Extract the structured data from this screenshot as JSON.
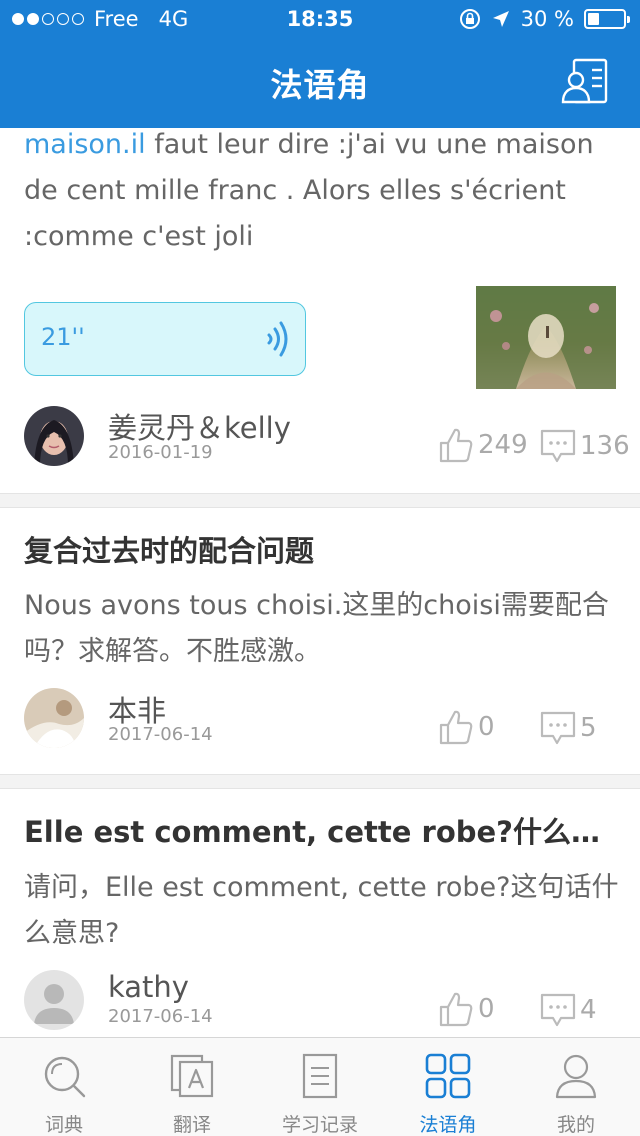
{
  "status_bar": {
    "carrier": "Free",
    "network": "4G",
    "time": "18:35",
    "battery_text": "30 %",
    "battery_level": 0.3,
    "signal_bars_filled": 2,
    "signal_bars_total": 5
  },
  "header": {
    "title": "法语角"
  },
  "colors": {
    "primary": "#1a7fd4",
    "link": "#3a9be0",
    "voice_bg": "#d8f7fb"
  },
  "posts": [
    {
      "body_link": "maison.il",
      "body_rest": " faut leur dire :j'ai vu une maison de cent mille franc . Alors elles s'écrient :comme c'est joli",
      "voice_duration": "21''",
      "author": "姜灵丹＆kelly",
      "date": "2016-01-19",
      "likes": "249",
      "comments": "136"
    },
    {
      "title": "复合过去时的配合问题",
      "body": "Nous avons tous choisi.这里的choisi需要配合吗？求解答。不胜感激。",
      "author": "本非",
      "date": "2017-06-14",
      "likes": "0",
      "comments": "5"
    },
    {
      "title": "Elle est comment, cette robe?什么意…",
      "body": "请问，Elle est comment, cette robe?这句话什么意思?",
      "author": "kathy",
      "date": "2017-06-14",
      "likes": "0",
      "comments": "4"
    }
  ],
  "tabbar": {
    "tabs": [
      {
        "label": "词典",
        "icon": "search-icon"
      },
      {
        "label": "翻译",
        "icon": "translate-icon"
      },
      {
        "label": "学习记录",
        "icon": "document-icon"
      },
      {
        "label": "法语角",
        "icon": "grid-icon"
      },
      {
        "label": "我的",
        "icon": "person-icon"
      }
    ],
    "active_index": 3
  }
}
